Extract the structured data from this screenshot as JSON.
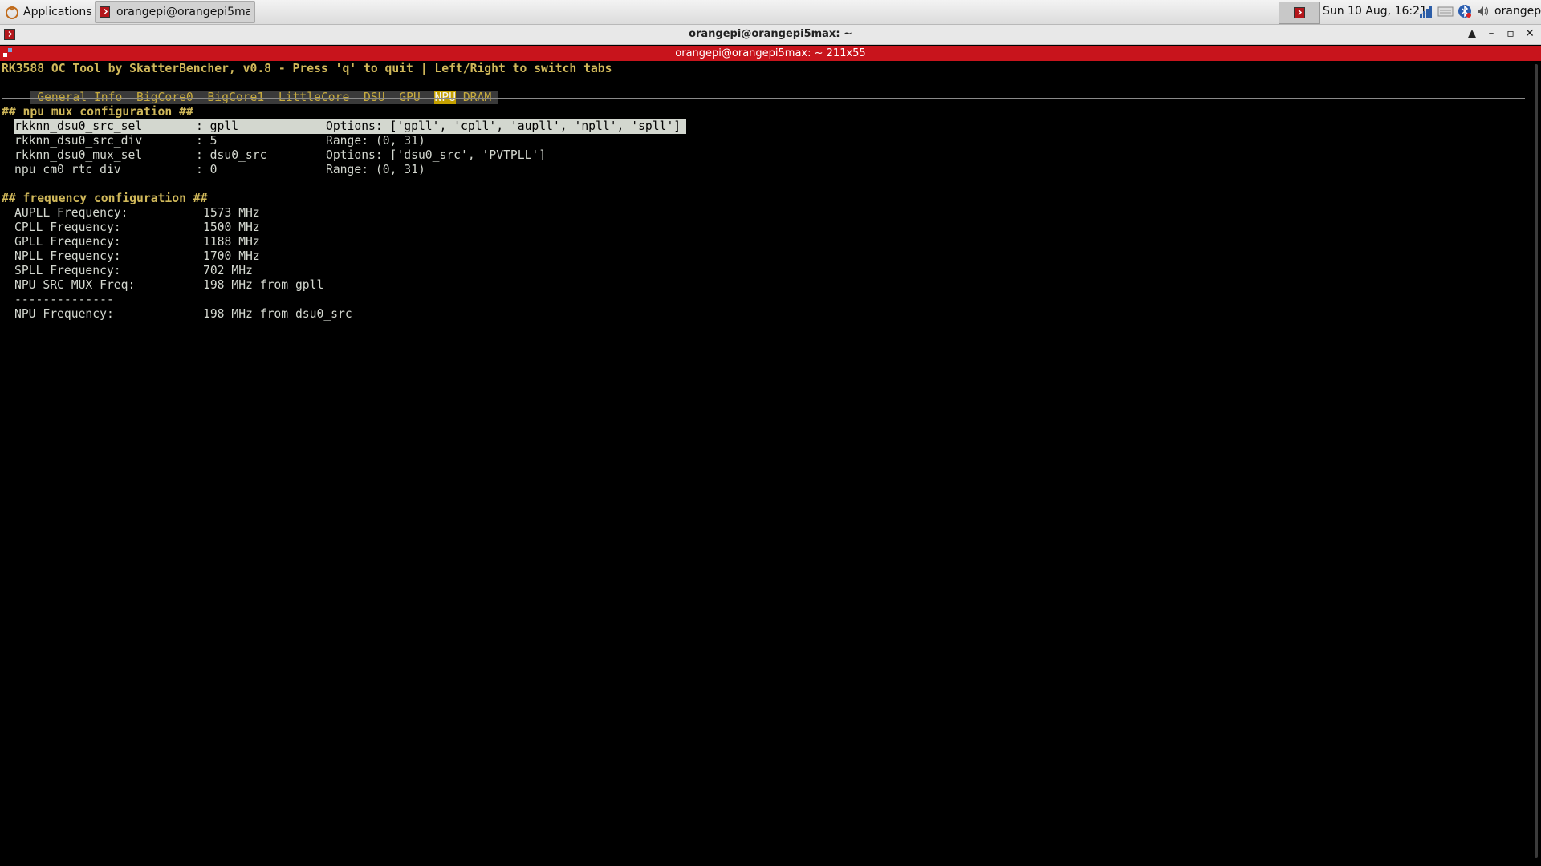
{
  "panel": {
    "applications_label": "Applications",
    "task_label": "orangepi@orangepi5ma...",
    "clock": "Sun 10 Aug, 16:21",
    "user": "orangepi"
  },
  "window": {
    "title": "orangepi@orangepi5max: ~",
    "subtitle": "orangepi@orangepi5max: ~ 211x55"
  },
  "terminal": {
    "header": "RK3588 OC Tool by SkatterBencher, v0.8 - Press 'q' to quit | Left/Right to switch tabs",
    "tabs": [
      {
        "label": "General Info",
        "selected": false
      },
      {
        "label": "BigCore0",
        "selected": false
      },
      {
        "label": "BigCore1",
        "selected": false
      },
      {
        "label": "LittleCore",
        "selected": false
      },
      {
        "label": "DSU",
        "selected": false
      },
      {
        "label": "GPU",
        "selected": false
      },
      {
        "label": "NPU",
        "selected": true
      },
      {
        "label": "DRAM",
        "selected": false
      }
    ],
    "mux_heading": "## npu mux configuration ##",
    "mux_rows": [
      {
        "name": "rkknn_dsu0_src_sel",
        "value": ": gpll",
        "info": "Options: ['gpll', 'cpll', 'aupll', 'npll', 'spll']",
        "selected": true
      },
      {
        "name": "rkknn_dsu0_src_div",
        "value": ": 5",
        "info": "Range: (0, 31)",
        "selected": false
      },
      {
        "name": "rkknn_dsu0_mux_sel",
        "value": ": dsu0_src",
        "info": "Options: ['dsu0_src', 'PVTPLL']",
        "selected": false
      },
      {
        "name": "npu_cm0_rtc_div",
        "value": ": 0",
        "info": "Range: (0, 31)",
        "selected": false
      }
    ],
    "freq_heading": "## frequency configuration ##",
    "freq_rows": [
      {
        "label": "AUPLL Frequency:",
        "value": "1573 MHz"
      },
      {
        "label": "CPLL Frequency:",
        "value": "1500 MHz"
      },
      {
        "label": "GPLL Frequency:",
        "value": "1188 MHz"
      },
      {
        "label": "NPLL Frequency:",
        "value": "1700 MHz"
      },
      {
        "label": "SPLL Frequency:",
        "value": "702 MHz"
      },
      {
        "label": "NPU SRC MUX Freq:",
        "value": "198 MHz from gpll"
      }
    ],
    "separator": "--------------",
    "npu_freq": {
      "label": "NPU Frequency:",
      "value": "198 MHz from dsu0_src"
    }
  },
  "colors": {
    "heading": "#d0b85a",
    "tab_text": "#c7ab3e",
    "tab_selected_bg": "#c4a000",
    "selection_bg": "#d3d7cf",
    "subbar_bg": "#c8141c"
  }
}
